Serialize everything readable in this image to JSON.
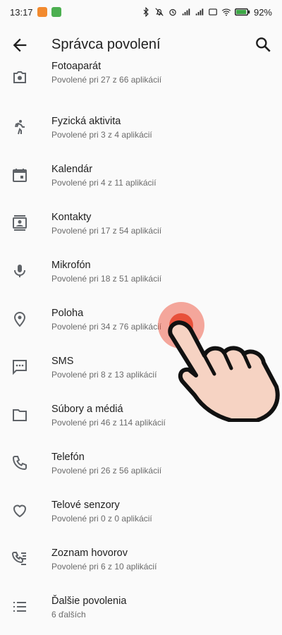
{
  "status_bar": {
    "time": "13:17",
    "battery": "92%",
    "icons": [
      "bluetooth-icon",
      "mute-icon",
      "alarm-icon",
      "signal-icon",
      "signal-icon",
      "vowifi-icon",
      "wifi-icon",
      "battery-icon"
    ]
  },
  "header": {
    "title": "Správca povolení",
    "back_icon": "arrow-left-icon",
    "search_icon": "search-icon"
  },
  "permissions": [
    {
      "title": "Fotoaparát",
      "subtitle": "Povolené pri 27 z 66 aplikácií",
      "icon": "camera-icon"
    },
    {
      "title": "Fyzická aktivita",
      "subtitle": "Povolené pri 3 z 4 aplikácií",
      "icon": "walking-icon"
    },
    {
      "title": "Kalendár",
      "subtitle": "Povolené pri 4 z 11 aplikácií",
      "icon": "calendar-icon"
    },
    {
      "title": "Kontakty",
      "subtitle": "Povolené pri 17 z 54 aplikácií",
      "icon": "contacts-icon"
    },
    {
      "title": "Mikrofón",
      "subtitle": "Povolené pri 18 z 51 aplikácií",
      "icon": "microphone-icon"
    },
    {
      "title": "Poloha",
      "subtitle": "Povolené pri 34 z 76 aplikácií",
      "icon": "location-icon"
    },
    {
      "title": "SMS",
      "subtitle": "Povolené pri 8 z 13 aplikácií",
      "icon": "sms-icon"
    },
    {
      "title": "Súbory a médiá",
      "subtitle": "Povolené pri 46 z 114 aplikácií",
      "icon": "folder-icon"
    },
    {
      "title": "Telefón",
      "subtitle": "Povolené pri 26 z 56 aplikácií",
      "icon": "phone-icon"
    },
    {
      "title": "Telové senzory",
      "subtitle": "Povolené pri 0 z 0 aplikácií",
      "icon": "heart-icon"
    },
    {
      "title": "Zoznam hovorov",
      "subtitle": "Povolené pri 6 z 10 aplikácií",
      "icon": "call-log-icon"
    },
    {
      "title": "Ďalšie povolenia",
      "subtitle": "6 ďalších",
      "icon": "list-icon"
    }
  ],
  "colors": {
    "background": "#fafafa",
    "text_primary": "#1f1f1f",
    "text_secondary": "#6b6b6b",
    "icon": "#5f6368",
    "touch_indicator": "#e8503a"
  }
}
